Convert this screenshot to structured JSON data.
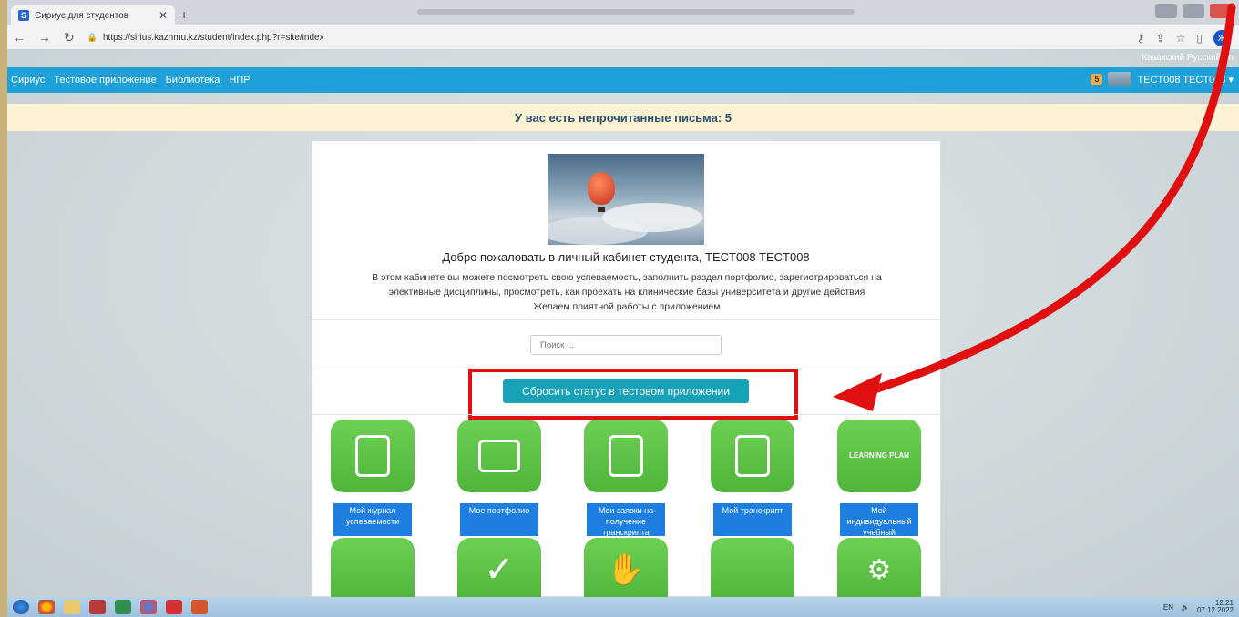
{
  "browser": {
    "tab_title": "Сириус для студентов",
    "tab_favicon": "S",
    "new_tab": "+",
    "url": "https://sirius.kaznmu.kz/student/index.php?r=site/index",
    "profile_initial": "Ж"
  },
  "lang": {
    "text": "Казахский Русский en"
  },
  "nav": {
    "items": [
      "Сириус",
      "Тестовое приложение",
      "Библиотека",
      "НПР"
    ],
    "mail_badge": "5",
    "user": "TECT008 TECT008 ▾"
  },
  "alert": "У вас есть непрочитанные письма: 5",
  "welcome": {
    "title": "Добро пожаловать в личный кабинет студента, TECT008 TECT008",
    "line1": "В этом кабинете вы можете посмотреть свою успеваемость, заполнить раздел портфолио, зарегистрироваться на",
    "line2": "элективные дисциплины, просмотреть, как проехать на клинические базы университета и другие действия",
    "line3": "Желаем приятной работы с приложением"
  },
  "search": {
    "placeholder": "Поиск ..."
  },
  "reset_button": "Сбросить статус в тестовом приложении",
  "tiles": [
    {
      "icon": "journal-icon",
      "label": "Мой журнал успеваемости"
    },
    {
      "icon": "briefcase-icon",
      "label": "Мое портфолио"
    },
    {
      "icon": "transcript-request-icon",
      "label": "Мои заявки на получение транскрипта"
    },
    {
      "icon": "transcript-icon",
      "label": "Мой транскрипт"
    },
    {
      "icon": "learning-plan-icon",
      "label": "Мой индивидуальный учебный"
    }
  ],
  "tiles_row2": [
    {
      "icon": "clipboard-student-icon"
    },
    {
      "icon": "checkmark-icon"
    },
    {
      "icon": "hand-icon"
    },
    {
      "icon": "hospital-icon"
    },
    {
      "icon": "head-gears-icon"
    }
  ],
  "learning_plan_text": "LEARNING PLAN",
  "taskbar": {
    "lang": "EN",
    "time": "12:21",
    "date": "07.12.2022"
  },
  "colors": {
    "navbar": "#1ea1d8",
    "reset_button": "#17a2b8",
    "tile_green": "#5cc245",
    "tile_label_blue": "#1e7fe0",
    "annotation_red": "#e01010"
  }
}
